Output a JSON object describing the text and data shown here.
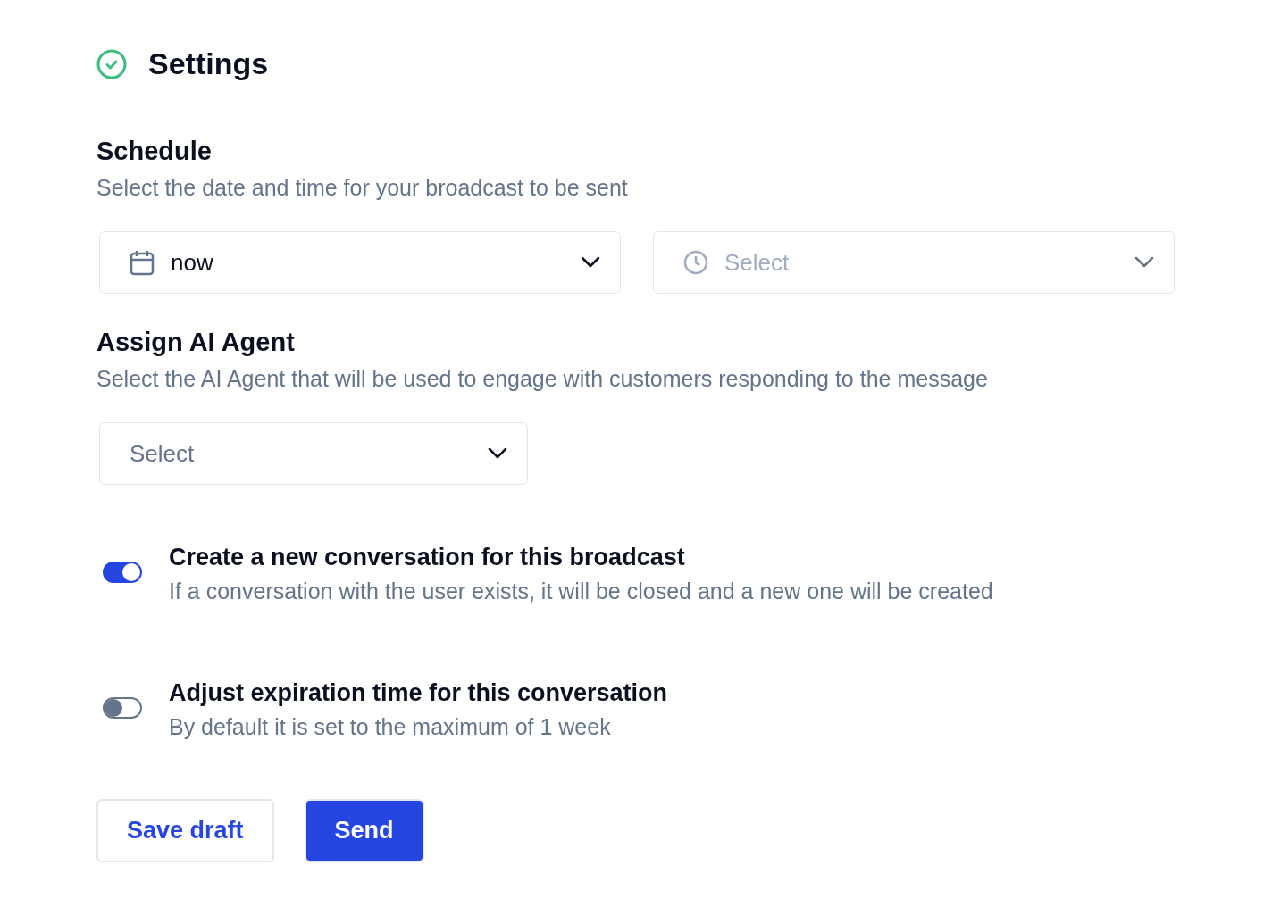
{
  "header": {
    "title": "Settings"
  },
  "schedule": {
    "title": "Schedule",
    "description": "Select the date and time for your broadcast to be sent",
    "fields": [
      {
        "kind": "date",
        "value": "now"
      },
      {
        "kind": "time",
        "placeholder": "Select"
      }
    ]
  },
  "agent": {
    "title": "Assign AI Agent",
    "description": "Select the AI Agent that will be used to engage with customers responding to the message",
    "fields": [
      {
        "kind": "plain",
        "placeholder": "Select"
      }
    ]
  },
  "toggles": [
    {
      "title": "Create a new conversation for this broadcast",
      "description": "If a conversation with the user exists, it will be closed and a new one will be created",
      "on": true
    },
    {
      "title": "Adjust expiration time for this conversation",
      "description": "By default it is set to the maximum of 1 week",
      "on": false
    }
  ],
  "buttons": [
    {
      "label": "Save draft",
      "kind": "secondary"
    },
    {
      "label": "Send",
      "kind": "primary"
    }
  ]
}
